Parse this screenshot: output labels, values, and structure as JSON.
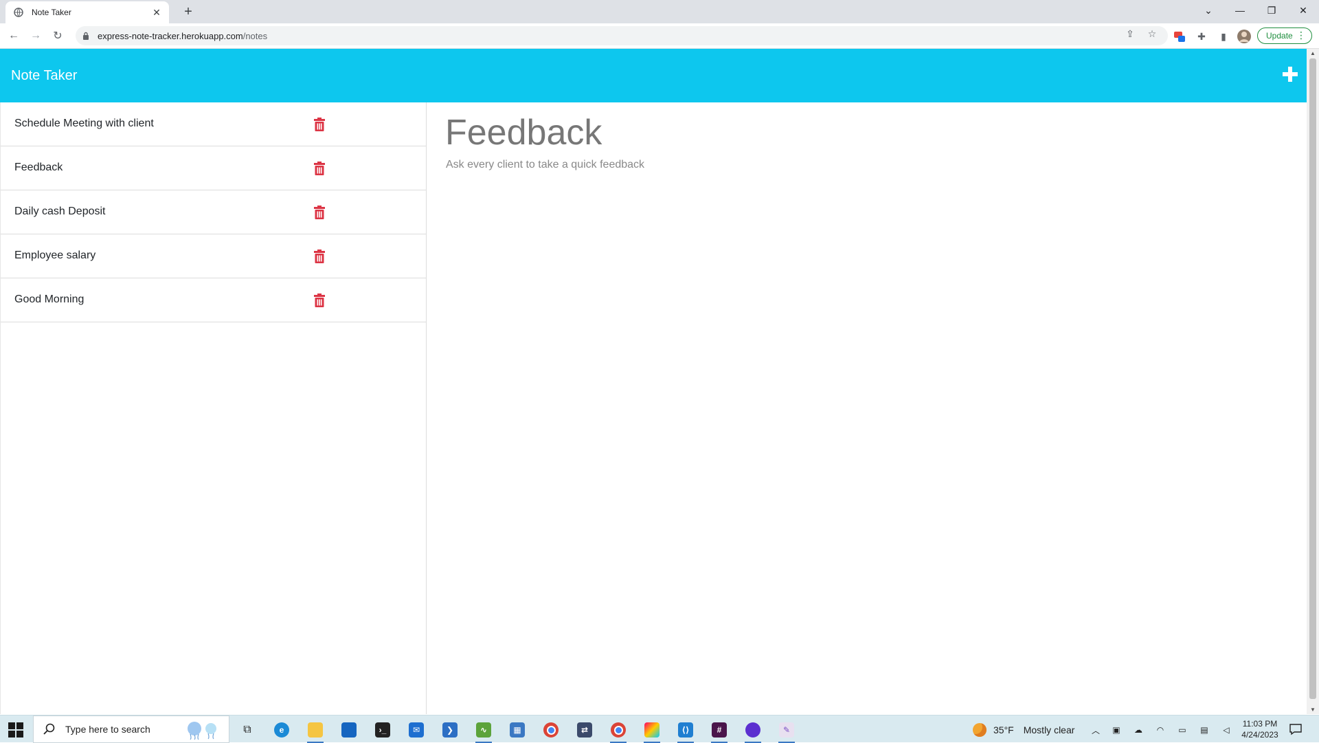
{
  "browser": {
    "tab_title": "Note Taker",
    "url_host": "express-note-tracker.herokuapp.com",
    "url_path": "/notes",
    "update_label": "Update"
  },
  "app": {
    "brand": "Note Taker",
    "notes": [
      {
        "title": "Schedule Meeting with client"
      },
      {
        "title": "Feedback"
      },
      {
        "title": "Daily cash Deposit"
      },
      {
        "title": "Employee salary"
      },
      {
        "title": "Good Morning"
      }
    ],
    "active_note": {
      "title": "Feedback",
      "text": "Ask every client to take a quick feedback"
    },
    "colors": {
      "header": "#0dc7ee",
      "trash": "#dc3545"
    }
  },
  "taskbar": {
    "search_placeholder": "Type here to search",
    "weather_temp": "35°F",
    "weather_desc": "Mostly clear",
    "time": "11:03 PM",
    "date": "4/24/2023"
  }
}
